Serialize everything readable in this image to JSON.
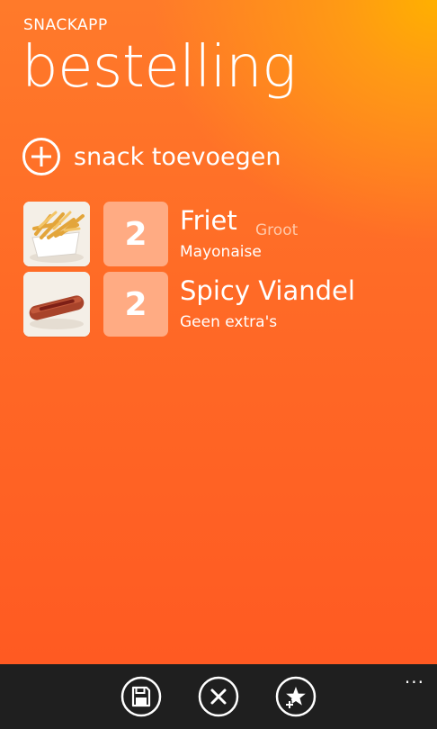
{
  "app": {
    "name": "SNACKAPP",
    "page_title": "bestelling"
  },
  "actions": {
    "add_snack_label": "snack toevoegen"
  },
  "orders": [
    {
      "quantity": "2",
      "name": "Friet",
      "size": "Groot",
      "extra": "Mayonaise",
      "thumbnail_icon": "fries-icon"
    },
    {
      "quantity": "2",
      "name": "Spicy Viandel",
      "size": "",
      "extra": "Geen extra's",
      "thumbnail_icon": "viandel-icon"
    }
  ],
  "app_bar": {
    "buttons": [
      "save-icon",
      "cancel-icon",
      "favorite-add-icon"
    ],
    "more": "..."
  },
  "colors": {
    "accent": "#ff6a26",
    "highlight": "#ffb000",
    "quantity_tile": "#ffab83",
    "app_bar": "#1f1f1f"
  }
}
